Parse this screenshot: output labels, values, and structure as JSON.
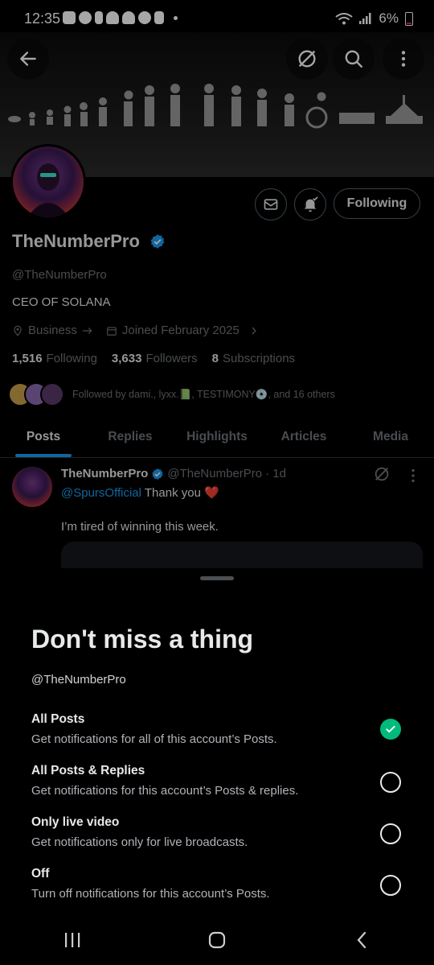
{
  "status_bar": {
    "time": "12:35",
    "battery": "6%"
  },
  "colors": {
    "accent": "#1d9bf0",
    "check": "#00ba7c",
    "heart": "#f91880"
  },
  "profile": {
    "display_name": "TheNumberPro",
    "handle": "@TheNumberPro",
    "bio": "CEO OF SOLANA",
    "category": "Business",
    "joined": "Joined February 2025",
    "following_count": "1,516",
    "following_label": "Following",
    "followers_count": "3,633",
    "followers_label": "Followers",
    "subscriptions_count": "8",
    "subscriptions_label": "Subscriptions",
    "followed_by": "Followed by dami., lyxx.📗, TESTIMONY💿, and 16 others",
    "following_button": "Following"
  },
  "tabs": [
    "Posts",
    "Replies",
    "Highlights",
    "Articles",
    "Media"
  ],
  "post": {
    "name": "TheNumberPro",
    "handle": "@TheNumberPro",
    "age": "· 1d",
    "mention": "@SpursOfficial",
    "line1_text": " Thank you ❤️",
    "line2": "I’m tired of winning this week."
  },
  "sheet": {
    "title": "Don't miss a thing",
    "handle": "@TheNumberPro",
    "options": [
      {
        "title": "All Posts",
        "desc": "Get notifications for all of this account’s Posts.",
        "selected": true
      },
      {
        "title": "All Posts & Replies",
        "desc": "Get notifications for this account’s Posts & replies.",
        "selected": false
      },
      {
        "title": "Only live video",
        "desc": "Get notifications only for live broadcasts.",
        "selected": false
      },
      {
        "title": "Off",
        "desc": "Turn off notifications for this account’s Posts.",
        "selected": false
      }
    ]
  }
}
